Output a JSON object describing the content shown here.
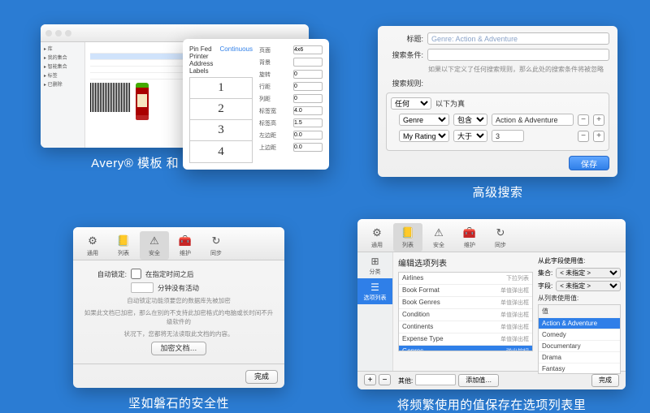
{
  "captions": {
    "p1": "Avery® 模板 和 条形码生成器",
    "p2": "高级搜索",
    "p3": "坚如磐石的安全性",
    "p4": "将频繁使用的值保存在选项列表里"
  },
  "panel1": {
    "popover_title": "Pin Fed Printer Address Labels",
    "popover_continuous": "Continuous",
    "cells": [
      "1",
      "2",
      "3",
      "4"
    ],
    "props": [
      {
        "k": "页面",
        "v": "4x6"
      },
      {
        "k": "背景",
        "v": ""
      },
      {
        "k": "旋转",
        "v": "0"
      },
      {
        "k": "行距",
        "v": "0"
      },
      {
        "k": "列距",
        "v": "0"
      },
      {
        "k": "标签宽",
        "v": "4.0"
      },
      {
        "k": "标签高",
        "v": "1.5"
      },
      {
        "k": "左边距",
        "v": "0.0"
      },
      {
        "k": "上边距",
        "v": "0.0"
      }
    ]
  },
  "panel2": {
    "title_label": "标题:",
    "title_value": "Genre: Action & Adventure",
    "cond_label": "搜索条件:",
    "cond_hint": "如果以下定义了任何搜索规则，那么此处的搜索条件将被忽略",
    "rules_label": "搜索规则:",
    "any": "任何",
    "truefor": "以下为真",
    "rule1_field": "Genre",
    "rule1_op": "包含",
    "rule1_val": "Action & Adventure",
    "rule2_field": "My Rating",
    "rule2_op": "大于",
    "rule2_val": "3",
    "save": "保存"
  },
  "panel3": {
    "tabs": [
      {
        "icon": "⚙",
        "label": "通用"
      },
      {
        "icon": "📒",
        "label": "列表"
      },
      {
        "icon": "⚠",
        "label": "安全"
      },
      {
        "icon": "🧰",
        "label": "维护"
      },
      {
        "icon": "↻",
        "label": "同步"
      }
    ],
    "active_tab": 2,
    "lock_label": "自动锁定:",
    "lock_chk": "在指定时间之后",
    "lock_min": "分钟没有活动",
    "lock_hint": "自动锁定功能须要您的数据库先被加密",
    "enc_hint1": "如果此文档已加密，那么在别的不支持此加密格式的电脑或长时间不升级软件的",
    "enc_hint2": "状况下，您都将无法读取此文档的内容。",
    "enc_btn": "加密文档…",
    "done": "完成"
  },
  "panel4": {
    "tabs": [
      {
        "icon": "⚙",
        "label": "通用"
      },
      {
        "icon": "📒",
        "label": "列表"
      },
      {
        "icon": "⚠",
        "label": "安全"
      },
      {
        "icon": "🧰",
        "label": "维护"
      },
      {
        "icon": "↻",
        "label": "同步"
      }
    ],
    "nav": [
      {
        "icon": "⊞",
        "label": "分类"
      },
      {
        "icon": "☰",
        "label": "选项列表"
      }
    ],
    "heading": "编辑选项列表",
    "from_field_label": "从此字段使用值:",
    "from_collection": "集合:",
    "unspecified": "< 未指定 >",
    "field_lbl": "字段:",
    "from_list_label": "从列表使用值:",
    "value_col": "值",
    "columns": [
      {
        "name": "Airlines",
        "sub": "下拉列表"
      },
      {
        "name": "Book Format",
        "sub": "单值弹出框"
      },
      {
        "name": "Book Genres",
        "sub": "单值弹出框"
      },
      {
        "name": "Condition",
        "sub": "单值弹出框"
      },
      {
        "name": "Continents",
        "sub": "单值弹出框"
      },
      {
        "name": "Expense Type",
        "sub": "单值弹出框"
      },
      {
        "name": "Genres",
        "sub": "弹出按钮"
      }
    ],
    "selected_col": 6,
    "values": [
      "Action & Adventure",
      "Comedy",
      "Documentary",
      "Drama",
      "Fantasy"
    ],
    "selected_val": 0,
    "other": "其他:",
    "add_value": "添加值…",
    "done": "完成"
  }
}
